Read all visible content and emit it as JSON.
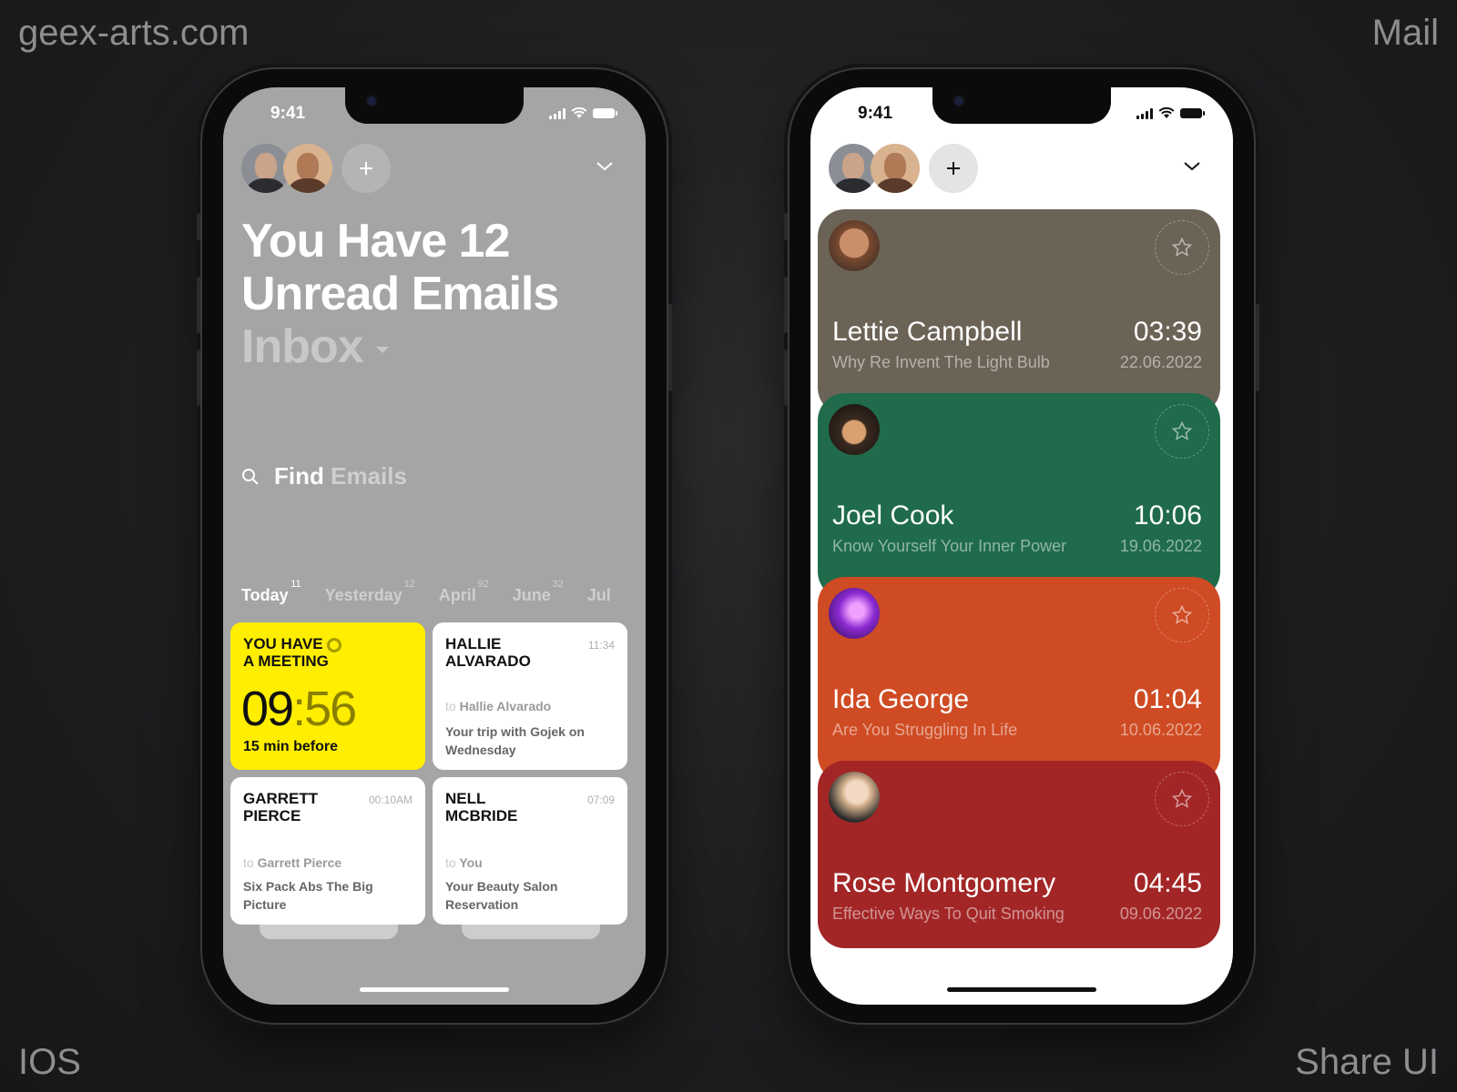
{
  "watermarks": {
    "top_left": "geex-arts.com",
    "top_right": "Mail",
    "bottom_left": "IOS",
    "bottom_right": "Share UI"
  },
  "left_phone": {
    "status_time": "9:41",
    "headline_line1": "You Have 12",
    "headline_line2": "Unread Emails",
    "folder": "Inbox",
    "search": {
      "word1": "Find",
      "word2": "Emails"
    },
    "tabs": [
      {
        "label": "Today",
        "count": "11"
      },
      {
        "label": "Yesterday",
        "count": "12"
      },
      {
        "label": "April",
        "count": "92"
      },
      {
        "label": "June",
        "count": "32"
      },
      {
        "label": "Jul",
        "count": ""
      }
    ],
    "meeting": {
      "title_line1": "YOU HAVE",
      "title_line2": "A MEETING",
      "hour": "09",
      "minute": ":56",
      "note": "15 min before",
      "color": "#ffee00"
    },
    "cards": [
      {
        "name_line1": "HALLIE",
        "name_line2": "ALVARADO",
        "time": "11:34",
        "to_prefix": "to",
        "to": "Hallie Alvarado",
        "subject": "Your trip with Gojek on Wednesday"
      },
      {
        "name_line1": "GARRETT",
        "name_line2": "PIERCE",
        "time": "00:10AM",
        "to_prefix": "to",
        "to": "Garrett Pierce",
        "subject": "Six Pack Abs The Big Picture"
      },
      {
        "name_line1": "NELL",
        "name_line2": "MCBRIDE",
        "time": "07:09",
        "to_prefix": "to",
        "to": "You",
        "subject": "Your Beauty Salon Reservation"
      }
    ]
  },
  "right_phone": {
    "status_time": "9:41",
    "emails": [
      {
        "sender": "Lettie Campbell",
        "time": "03:39",
        "subject": "Why Re Invent The Light Bulb",
        "date": "22.06.2022",
        "color": "#6b6356"
      },
      {
        "sender": "Joel Cook",
        "time": "10:06",
        "subject": "Know Yourself Your Inner Power",
        "date": "19.06.2022",
        "color": "#1f6b4b"
      },
      {
        "sender": "Ida George",
        "time": "01:04",
        "subject": "Are You Struggling In Life",
        "date": "10.06.2022",
        "color": "#cf4b23"
      },
      {
        "sender": "Rose Montgomery",
        "time": "04:45",
        "subject": "Effective Ways To Quit Smoking",
        "date": "09.06.2022",
        "color": "#a32626"
      }
    ]
  },
  "icons": [
    "plus-icon",
    "chevron-down-icon",
    "search-icon",
    "star-icon",
    "signal-icon",
    "wifi-icon",
    "battery-icon"
  ]
}
